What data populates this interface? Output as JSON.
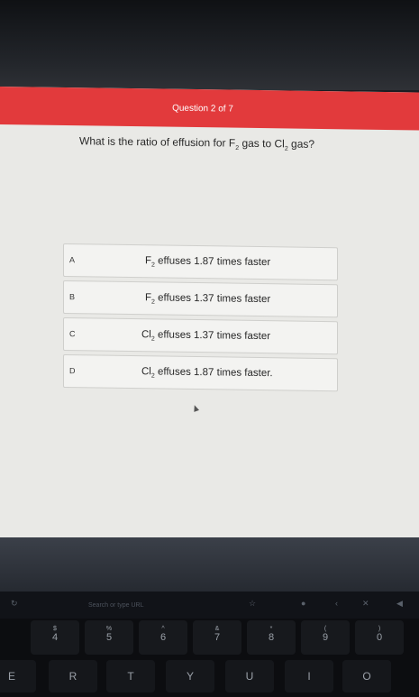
{
  "quiz": {
    "counter": "Question 2 of 7",
    "question": {
      "prefix": "What is the ratio of effusion for F",
      "sub1": "2",
      "middle": " gas to Cl",
      "sub2": "2",
      "suffix": " gas?"
    },
    "options": [
      {
        "letter": "A",
        "species": "F",
        "sub": "2",
        "text": " effuses 1.87 times faster"
      },
      {
        "letter": "B",
        "species": "F",
        "sub": "2",
        "text": " effuses 1.37 times faster"
      },
      {
        "letter": "C",
        "species": "Cl",
        "sub": "2",
        "text": " effuses 1.37 times faster"
      },
      {
        "letter": "D",
        "species": "Cl",
        "sub": "2",
        "text": " effuses 1.87 times faster."
      }
    ]
  },
  "touchbar": {
    "search": "Search or type URL"
  },
  "keyboard": {
    "number_row": [
      {
        "sym": "$",
        "num": "4"
      },
      {
        "sym": "%",
        "num": "5"
      },
      {
        "sym": "^",
        "num": "6"
      },
      {
        "sym": "&",
        "num": "7"
      },
      {
        "sym": "*",
        "num": "8"
      },
      {
        "sym": "(",
        "num": "9"
      },
      {
        "sym": ")",
        "num": "0"
      }
    ],
    "letter_row": [
      "E",
      "R",
      "T",
      "Y",
      "U",
      "I",
      "O"
    ]
  }
}
